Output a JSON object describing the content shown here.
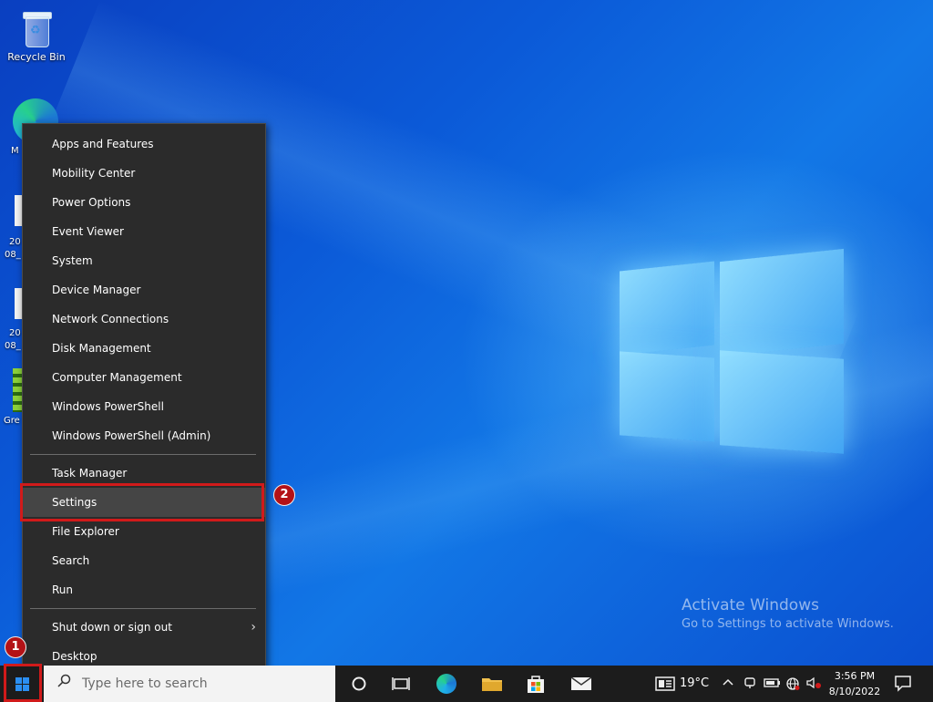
{
  "desktop": {
    "icons": [
      {
        "label": "Recycle Bin"
      }
    ],
    "fragments": [
      "M",
      "20",
      "08_",
      "20",
      "08_",
      "Gre"
    ],
    "watermark": {
      "title": "Activate Windows",
      "subtitle": "Go to Settings to activate Windows."
    }
  },
  "menu": {
    "group1": [
      {
        "label": "Apps and Features"
      },
      {
        "label": "Mobility Center"
      },
      {
        "label": "Power Options"
      },
      {
        "label": "Event Viewer"
      },
      {
        "label": "System"
      },
      {
        "label": "Device Manager"
      },
      {
        "label": "Network Connections"
      },
      {
        "label": "Disk Management"
      },
      {
        "label": "Computer Management"
      },
      {
        "label": "Windows PowerShell"
      },
      {
        "label": "Windows PowerShell (Admin)"
      }
    ],
    "group2": [
      {
        "label": "Task Manager"
      },
      {
        "label": "Settings"
      },
      {
        "label": "File Explorer"
      },
      {
        "label": "Search"
      },
      {
        "label": "Run"
      }
    ],
    "group3": [
      {
        "label": "Shut down or sign out",
        "submenu_chevron": "›"
      },
      {
        "label": "Desktop"
      }
    ],
    "selected_item": "Settings"
  },
  "annotations": {
    "step1": "1",
    "step2": "2",
    "highlight_color": "#d11a1a"
  },
  "taskbar": {
    "search_placeholder": "Type here to search",
    "icons": [
      "windows-start-icon",
      "cortana-icon",
      "task-view-icon",
      "edge-icon",
      "file-explorer-icon",
      "microsoft-store-icon",
      "mail-icon"
    ],
    "weather": {
      "temp": "19°C"
    },
    "tray_icons": [
      "chevron-up-icon",
      "meet-now-icon",
      "battery-icon",
      "network-icon",
      "volume-muted-icon"
    ],
    "clock": {
      "time": "3:56 PM",
      "date": "8/10/2022"
    }
  },
  "colors": {
    "menu_bg": "#2b2b2b",
    "menu_selected": "#454545",
    "taskbar_bg": "#1c1c1c",
    "accent": "#2b8ff2"
  }
}
